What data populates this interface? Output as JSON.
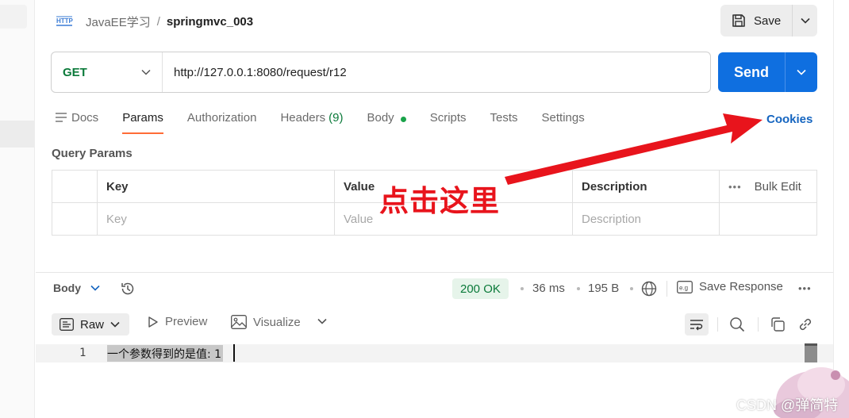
{
  "header": {
    "breadcrumb_parent": "JavaEE学习",
    "breadcrumb_sep": "/",
    "request_name": "springmvc_003",
    "save_label": "Save"
  },
  "request": {
    "method": "GET",
    "url": "http://127.0.0.1:8080/request/r12",
    "send_label": "Send"
  },
  "tabs": [
    {
      "label": "Docs"
    },
    {
      "label": "Params",
      "active": true
    },
    {
      "label": "Authorization"
    },
    {
      "label": "Headers",
      "count": "(9)"
    },
    {
      "label": "Body",
      "has_dot": true
    },
    {
      "label": "Scripts"
    },
    {
      "label": "Tests"
    },
    {
      "label": "Settings"
    }
  ],
  "cookies_label": "Cookies",
  "query_params": {
    "title": "Query Params",
    "columns": [
      "Key",
      "Value",
      "Description"
    ],
    "bulk_edit": "Bulk Edit",
    "placeholders": {
      "key": "Key",
      "value": "Value",
      "description": "Description"
    }
  },
  "annotation": {
    "text": "点击这里",
    "color": "#e8141c"
  },
  "response": {
    "body_label": "Body",
    "status": "200 OK",
    "time": "36 ms",
    "size": "195 B",
    "save_response": "Save Response",
    "formats": {
      "raw": "Raw",
      "preview": "Preview",
      "visualize": "Visualize"
    },
    "lines": [
      {
        "num": "1",
        "text": "一个参数得到的是值: 1"
      }
    ]
  },
  "watermark": "CSDN @弹简特",
  "colors": {
    "send": "#0f6fe0",
    "method_get": "#0b7a3a",
    "active_tab_underline": "#ff6c37",
    "status_ok_bg": "#e6f4ea",
    "link": "#1565c0"
  }
}
